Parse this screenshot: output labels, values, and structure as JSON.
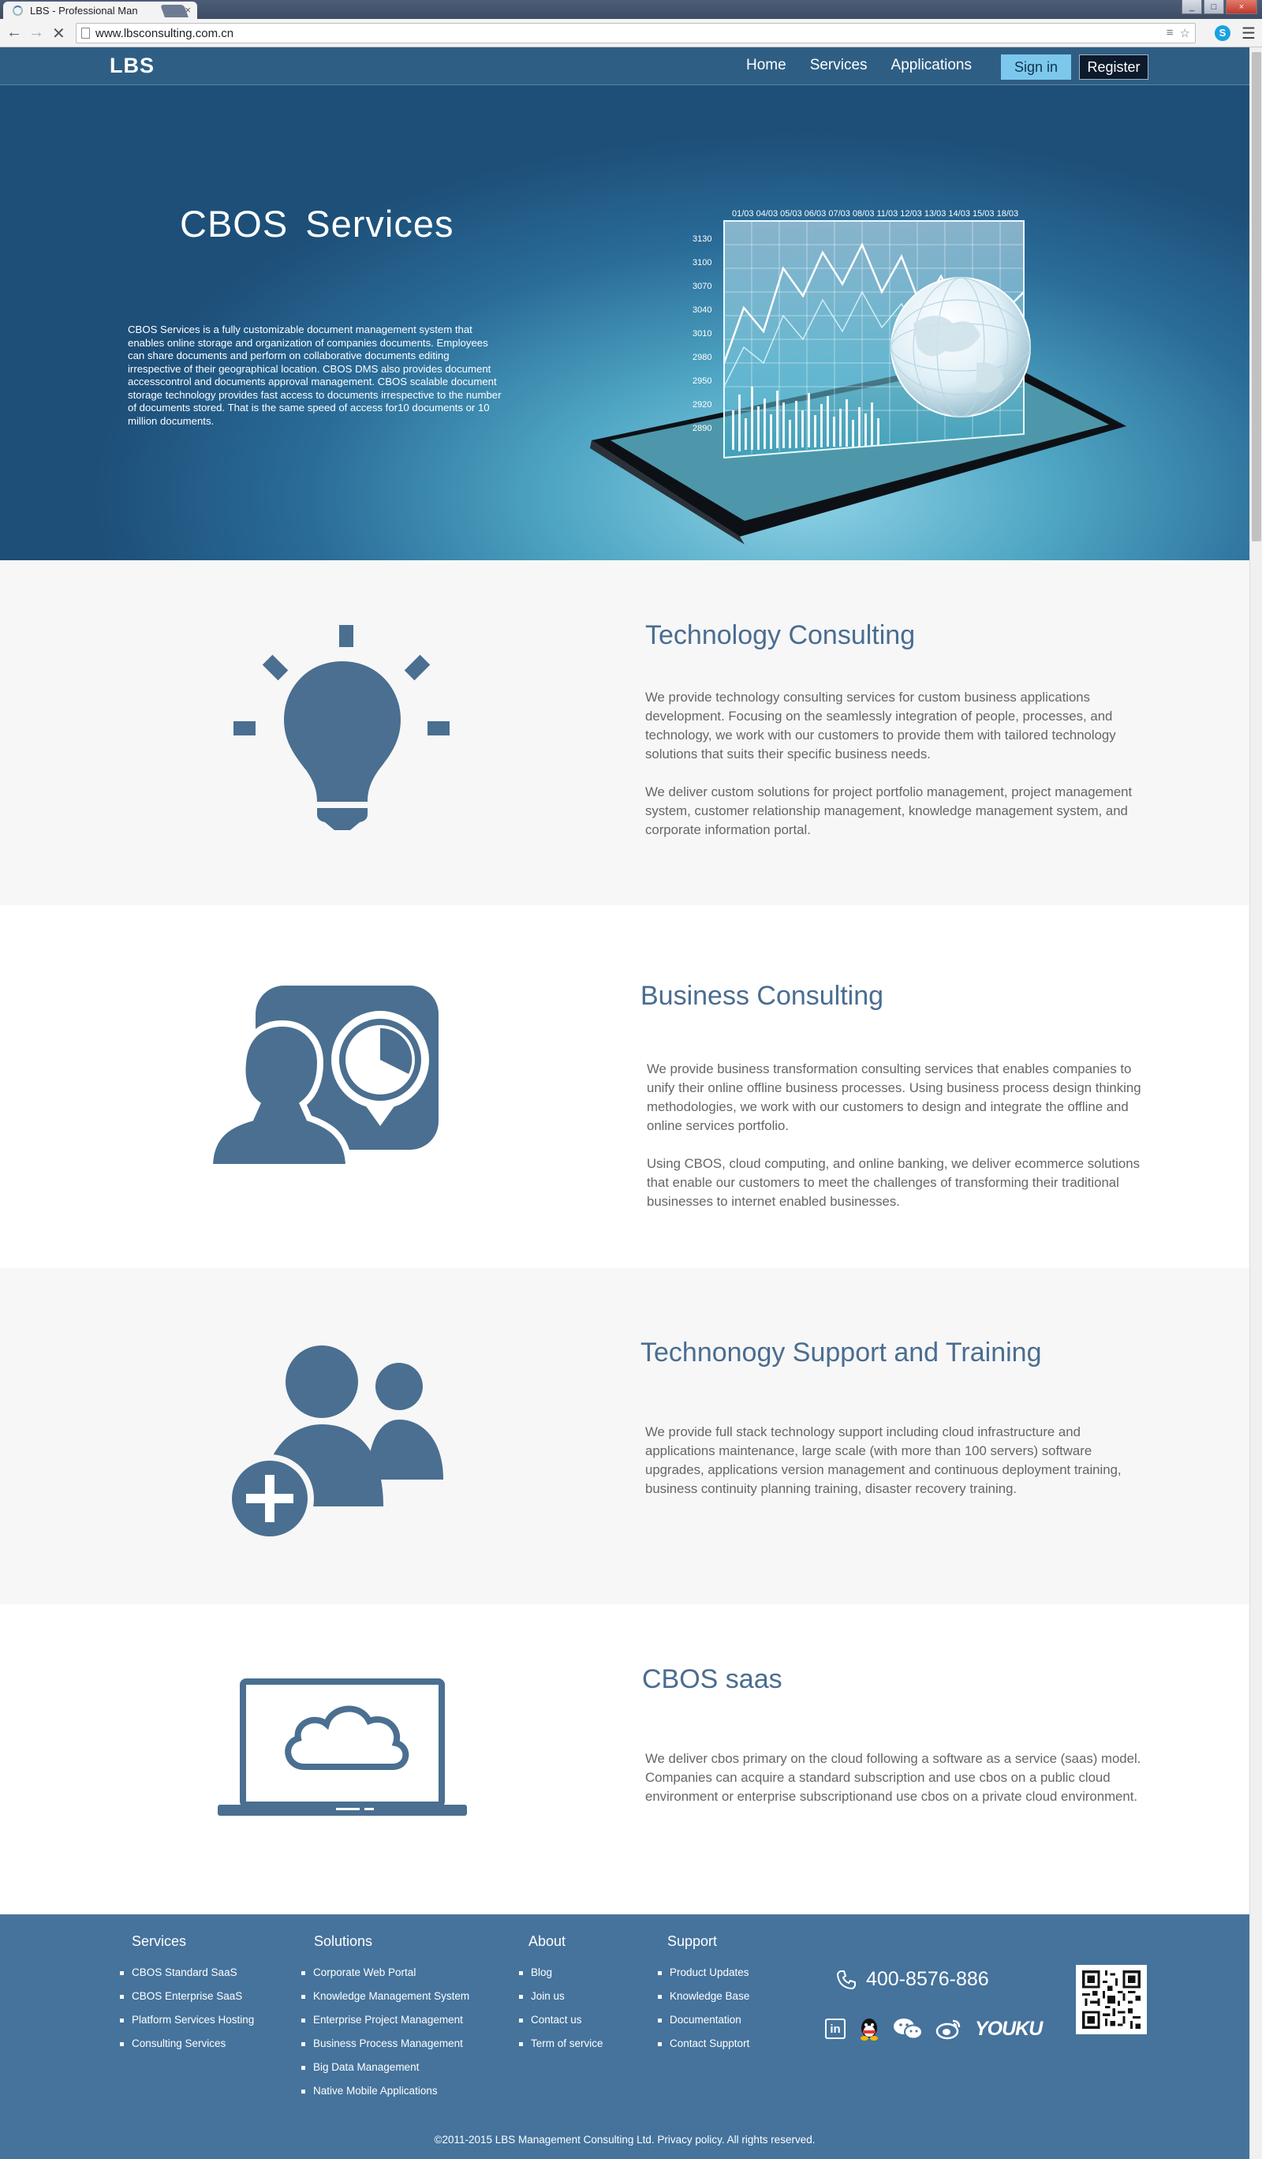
{
  "browser": {
    "tab_title": "LBS - Professional Man",
    "tab_close": "×",
    "url": "www.lbsconsulting.com.cn",
    "window_buttons": [
      "_",
      "□",
      "×"
    ]
  },
  "header": {
    "logo": "LBS",
    "nav": [
      "Home",
      "Services",
      "Applications"
    ],
    "signin": "Sign in",
    "register": "Register"
  },
  "hero": {
    "title": "CBOS  Services",
    "description": "CBOS Services is a fully customizable document management system  that enables online storage and organization of companies documents. Employees can share documents  and perform on collaborative documents editing irrespective of their geographical location.  CBOS DMS also provides document accesscontrol  and documents approval management. CBOS scalable document storage technology provides fast access to documents irrespective to the number of documents stored. That is the same speed of access for10 documents or 10 million documents.",
    "chart_dates": "01/03 04/03 05/03 06/03 07/03 08/03 11/03 12/03 13/03 14/03 15/03 18/03",
    "chart_levels": [
      "3130",
      "3100",
      "3070",
      "3040",
      "3010",
      "2980",
      "2950",
      "2920",
      "2890"
    ]
  },
  "services": [
    {
      "title": "Technology Consulting",
      "paragraphs": [
        "We provide technology consulting services for custom business applications development. Focusing on the seamlessly integration of people, processes, and technology, we work with our customers to provide them with tailored technology solutions that suits their specific business needs.",
        "We deliver custom solutions for project portfolio management, project management system, customer relationship management, knowledge management system, and corporate information portal."
      ]
    },
    {
      "title": "Business Consulting",
      "paragraphs": [
        "We provide business transformation consulting services that enables companies to unify their online offline business processes.  Using business process design thinking methodologies, we work with our customers to design and integrate the offline and online services portfolio.",
        "Using CBOS, cloud computing, and online banking, we deliver ecommerce solutions that enable our customers to meet the challenges of transforming their traditional businesses to internet enabled businesses."
      ]
    },
    {
      "title": "Technonogy Support and Training",
      "paragraphs": [
        "We provide full stack technology support including cloud infrastructure and applications maintenance, large scale (with more than 100 servers) software upgrades, applications version management and continuous deployment training, business continuity planning training, disaster recovery training."
      ]
    },
    {
      "title": "CBOS saas",
      "paragraphs": [
        "We deliver cbos primary on the cloud following a software as a service (saas) model. Companies can acquire a standard subscription and use cbos on a public cloud environment or enterprise subscriptionand use cbos on a private cloud environment."
      ]
    }
  ],
  "footer": {
    "columns": [
      {
        "heading": "Services",
        "items": [
          "CBOS Standard SaaS",
          "CBOS Enterprise SaaS",
          "Platform Services Hosting",
          "Consulting Services"
        ]
      },
      {
        "heading": "Solutions",
        "items": [
          "Corporate Web Portal",
          "Knowledge Management System",
          "Enterprise Project Management",
          "Business Process Management",
          "Big Data Management",
          "Native Mobile Applications"
        ]
      },
      {
        "heading": "About",
        "items": [
          "Blog",
          "Join us",
          "Contact us",
          "Term of service"
        ]
      },
      {
        "heading": "Support",
        "items": [
          "Product Updates",
          "Knowledge Base",
          "Documentation",
          "Contact Supptort"
        ]
      }
    ],
    "phone": "400-8576-886",
    "linkedin": "in",
    "youku": "YOUKU",
    "copyright": "©2011-2015 LBS Management Consulting Ltd. Privacy policy.  All rights reserved."
  }
}
